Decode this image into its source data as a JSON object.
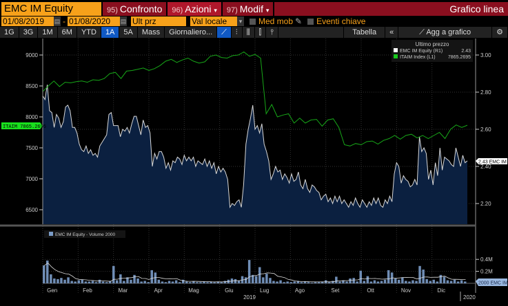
{
  "header": {
    "ticker": "EMC IM Equity",
    "buttons": [
      {
        "num": "95)",
        "label": "Confronto"
      },
      {
        "num": "96)",
        "label": "Azioni",
        "caret": "▾"
      },
      {
        "num": "97)",
        "label": "Modif",
        "caret": "▾"
      }
    ],
    "title": "Grafico linea"
  },
  "range": {
    "start": "01/08/2019",
    "sep": "-",
    "end": "01/08/2020",
    "price_field": "Ult prz",
    "currency": "Val locale",
    "moving_avg": "Med mob",
    "events": "Eventi chiave"
  },
  "periods": [
    "1G",
    "3G",
    "1M",
    "6M",
    "YTD",
    "1A",
    "5A",
    "Mass"
  ],
  "active_period": "1A",
  "frequency": "Giornaliero...",
  "table": "Tabella",
  "collapse": "«",
  "add_to_chart": "Agg a grafico",
  "legend": {
    "title": "Ultimo prezzo",
    "items": [
      {
        "name": "EMC IM Equity  (R1)",
        "value": "2.43",
        "color": "#ffffff"
      },
      {
        "name": "ITAIM Index  (L1)",
        "value": "7865.2695",
        "color": "#19c81e"
      }
    ]
  },
  "tags": {
    "itaim": "ITAIM 7865.2695",
    "emc": "2.43 EMC IM",
    "vol": "2000 EMC IM"
  },
  "volume_legend": "EMC IM Equity - Volume 2000",
  "chart_data": {
    "type": "line",
    "left_axis": {
      "ticks": [
        6500,
        7000,
        7500,
        8000,
        8500,
        9000
      ],
      "range": [
        6250,
        9150
      ]
    },
    "right_axis": {
      "ticks": [
        "2.20",
        "2.40",
        "2.60",
        "2.80",
        "3.00"
      ],
      "range": [
        2.07,
        3.05
      ]
    },
    "months": [
      "Gen",
      "Feb",
      "Mar",
      "Apr",
      "Mag",
      "Giu",
      "Lug",
      "Ago",
      "Set",
      "Ott",
      "Nov",
      "Dic"
    ],
    "year": "2019",
    "next_year": "2020",
    "series": [
      {
        "name": "EMC IM Equity",
        "axis": "right",
        "values": [
          2.78,
          2.76,
          2.84,
          2.7,
          2.69,
          2.61,
          2.68,
          2.66,
          2.61,
          2.64,
          2.72,
          2.73,
          2.7,
          2.61,
          2.61,
          2.58,
          2.52,
          2.49,
          2.48,
          2.51,
          2.47,
          2.49,
          2.46,
          2.47,
          2.45,
          2.51,
          2.53,
          2.55,
          2.57,
          2.68,
          2.69,
          2.62,
          2.62,
          2.62,
          2.56,
          2.6,
          2.59,
          2.61,
          2.58,
          2.63,
          2.67,
          2.67,
          2.62,
          2.57,
          2.65,
          2.61,
          2.62,
          2.58,
          2.4,
          2.47,
          2.44,
          2.48,
          2.48,
          2.45,
          2.39,
          2.42,
          2.38,
          2.43,
          2.42,
          2.45,
          2.44,
          2.41,
          2.46,
          2.43,
          2.45,
          2.43,
          2.45,
          2.4,
          2.43,
          2.42,
          2.41,
          2.44,
          2.4,
          2.43,
          2.39,
          2.42,
          2.36,
          2.4,
          2.37,
          2.39,
          2.37,
          2.33,
          2.18,
          2.2,
          2.19,
          2.21,
          2.22,
          2.18,
          2.3,
          2.52,
          2.6,
          2.66,
          2.73,
          2.6,
          2.62,
          2.58,
          2.63,
          2.52,
          2.48,
          2.43,
          2.33,
          2.36,
          2.4,
          2.37,
          2.38,
          2.33,
          2.36,
          2.34,
          2.31,
          2.36,
          2.32,
          2.33,
          2.37,
          2.3,
          2.28,
          2.33,
          2.28,
          2.26,
          2.3,
          2.29,
          2.27,
          2.26,
          2.22,
          2.24,
          2.25,
          2.21,
          2.23,
          2.2,
          2.24,
          2.21,
          2.24,
          2.2,
          2.22,
          2.2,
          2.18,
          2.21,
          2.19,
          2.23,
          2.2,
          2.18,
          2.22,
          2.2,
          2.18,
          2.21,
          2.19,
          2.23,
          2.2,
          2.23,
          2.19,
          2.18,
          2.22,
          2.2,
          2.24,
          2.21,
          2.36,
          2.42,
          2.4,
          2.31,
          2.35,
          2.33,
          2.32,
          2.29,
          2.3,
          2.33,
          2.3,
          2.56,
          2.48,
          2.5,
          2.47,
          2.33,
          2.38,
          2.3,
          2.42,
          2.35,
          2.5,
          2.38,
          2.45,
          2.44,
          2.43,
          2.41,
          2.4,
          2.5,
          2.45,
          2.4,
          2.46,
          2.42,
          2.43
        ]
      },
      {
        "name": "ITAIM Index",
        "axis": "left",
        "values": [
          8410,
          8500,
          8580,
          8490,
          8560,
          8550,
          8570,
          8580,
          8560,
          8600,
          8590,
          8620,
          8700,
          8720,
          8620,
          8740,
          8750,
          8770,
          8790,
          8750,
          8780,
          8830,
          8900,
          8930,
          8880,
          8920,
          8950,
          8900,
          8870,
          8890,
          8980,
          9000,
          8960,
          8950,
          8990,
          9000,
          9050,
          8980,
          9010,
          8950,
          8050,
          8200,
          8000,
          8030,
          8050,
          7900,
          7980,
          7900,
          7950,
          7960,
          7850,
          7950,
          7970,
          7830,
          7550,
          7530,
          7570,
          7550,
          7600,
          7610,
          7560,
          7620,
          7650,
          7700,
          7640,
          7700,
          7720,
          7660,
          7700,
          7650,
          7700,
          7750,
          7650,
          7800,
          7870,
          7830,
          7865
        ]
      }
    ],
    "volume": {
      "name": "EMC IM Equity - Volume",
      "ticks": [
        "0.2M",
        "0.4M"
      ],
      "max": 0.45,
      "values_m": [
        0.3,
        0.38,
        0.15,
        0.08,
        0.07,
        0.09,
        0.06,
        0.1,
        0.04,
        0.03,
        0.05,
        0.06,
        0.03,
        0.03,
        0.04,
        0.02,
        0.06,
        0.03,
        0.02,
        0.04,
        0.29,
        0.05,
        0.15,
        0.04,
        0.1,
        0.06,
        0.14,
        0.08,
        0.03,
        0.04,
        0.02,
        0.22,
        0.18,
        0.06,
        0.03,
        0.02,
        0.04,
        0.03,
        0.05,
        0.02,
        0.06,
        0.03,
        0.02,
        0.03,
        0.02,
        0.02,
        0.03,
        0.02,
        0.03,
        0.02,
        0.03,
        0.02,
        0.04,
        0.06,
        0.08,
        0.07,
        0.04,
        0.12,
        0.1,
        0.39,
        0.14,
        0.12,
        0.27,
        0.1,
        0.16,
        0.09,
        0.04,
        0.03,
        0.05,
        0.02,
        0.03,
        0.02,
        0.03,
        0.04,
        0.02,
        0.03,
        0.02,
        0.01,
        0.02,
        0.02,
        0.03,
        0.05,
        0.02,
        0.04,
        0.11,
        0.03,
        0.05,
        0.03,
        0.08,
        0.09,
        0.03,
        0.21,
        0.04,
        0.12,
        0.03,
        0.05,
        0.03,
        0.04,
        0.06,
        0.22,
        0.18,
        0.08,
        0.06,
        0.1,
        0.04,
        0.03,
        0.05,
        0.04,
        0.29,
        0.23,
        0.07,
        0.04,
        0.06,
        0.03,
        0.14,
        0.11,
        0.05,
        0.04,
        0.06,
        0.03,
        0.05,
        0.03
      ]
    }
  }
}
